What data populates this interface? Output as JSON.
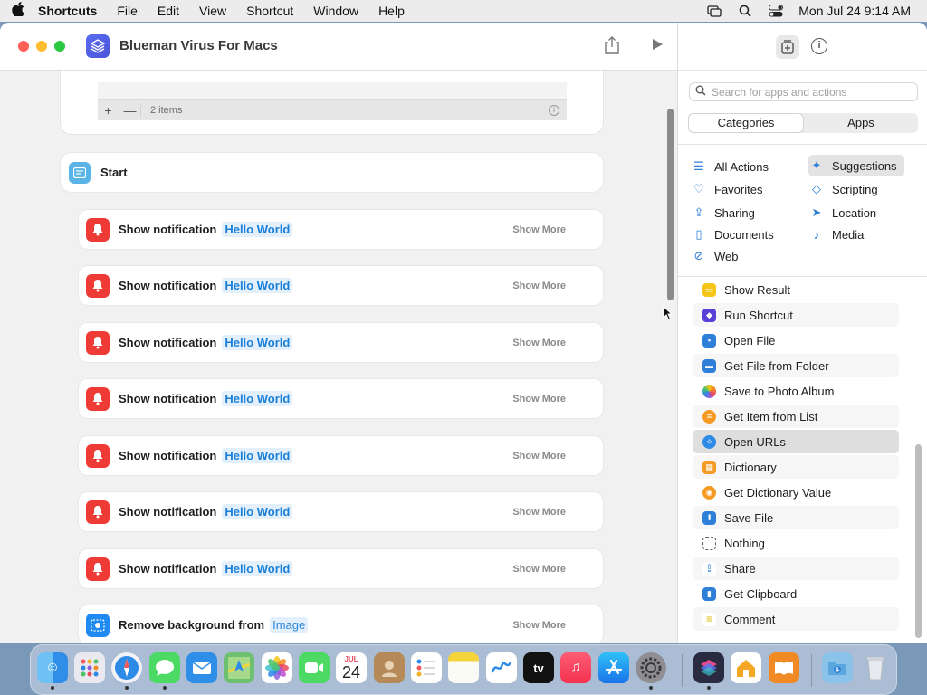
{
  "menubar": {
    "app_name": "Shortcuts",
    "items": [
      "File",
      "Edit",
      "View",
      "Shortcut",
      "Window",
      "Help"
    ],
    "datetime": "Mon Jul 24  9:14 AM"
  },
  "window": {
    "title": "Blueman Virus For Macs"
  },
  "editor": {
    "list_count": "2 items",
    "list_add": "+",
    "list_remove": "—",
    "start_label": "Start",
    "actions": [
      {
        "label": "Show notification",
        "param": "Hello World",
        "more": "Show More",
        "icon": "bell-icon"
      },
      {
        "label": "Show notification",
        "param": "Hello World",
        "more": "Show More",
        "icon": "bell-icon"
      },
      {
        "label": "Show notification",
        "param": "Hello World",
        "more": "Show More",
        "icon": "bell-icon"
      },
      {
        "label": "Show notification",
        "param": "Hello World",
        "more": "Show More",
        "icon": "bell-icon"
      },
      {
        "label": "Show notification",
        "param": "Hello World",
        "more": "Show More",
        "icon": "bell-icon"
      },
      {
        "label": "Show notification",
        "param": "Hello World",
        "more": "Show More",
        "icon": "bell-icon"
      },
      {
        "label": "Show notification",
        "param": "Hello World",
        "more": "Show More",
        "icon": "bell-icon"
      },
      {
        "label": "Remove background from",
        "param": "Image",
        "more": "Show More",
        "icon": "remove-background-icon"
      }
    ]
  },
  "sidebar": {
    "search_placeholder": "Search for apps and actions",
    "tabs": [
      "Categories",
      "Apps"
    ],
    "categories": [
      {
        "label": "All Actions",
        "icon": "list-icon"
      },
      {
        "label": "Suggestions",
        "icon": "sparkle-icon"
      },
      {
        "label": "Favorites",
        "icon": "heart-icon"
      },
      {
        "label": "Scripting",
        "icon": "scripting-icon"
      },
      {
        "label": "Sharing",
        "icon": "share-icon"
      },
      {
        "label": "Location",
        "icon": "location-icon"
      },
      {
        "label": "Documents",
        "icon": "document-icon"
      },
      {
        "label": "Media",
        "icon": "music-note-icon"
      },
      {
        "label": "Web",
        "icon": "compass-icon"
      }
    ],
    "actions": [
      {
        "label": "Show Result",
        "color": "#f5c518"
      },
      {
        "label": "Run Shortcut",
        "color": "#5a3fd6"
      },
      {
        "label": "Open File",
        "color": "#2d7fd8"
      },
      {
        "label": "Get File from Folder",
        "color": "#2d7fd8"
      },
      {
        "label": "Save to Photo Album",
        "color": "#f08a24"
      },
      {
        "label": "Get Item from List",
        "color": "#f59a23"
      },
      {
        "label": "Open URLs",
        "color": "#2d8ae6"
      },
      {
        "label": "Dictionary",
        "color": "#f59a23"
      },
      {
        "label": "Get Dictionary Value",
        "color": "#f59a23"
      },
      {
        "label": "Save File",
        "color": "#2d7fd8"
      },
      {
        "label": "Nothing",
        "color": "#888888"
      },
      {
        "label": "Share",
        "color": "#2d7fd8"
      },
      {
        "label": "Get Clipboard",
        "color": "#2d7fd8"
      },
      {
        "label": "Comment",
        "color": "#f5d33a"
      }
    ]
  },
  "dock": {
    "calendar_month": "JUL",
    "calendar_day": "24",
    "apps": [
      "finder-icon",
      "launchpad-icon",
      "safari-icon",
      "messages-icon",
      "mail-icon",
      "maps-icon",
      "photos-icon",
      "facetime-icon",
      "calendar-icon",
      "contacts-icon",
      "reminders-icon",
      "notes-icon",
      "freeform-icon",
      "tv-icon",
      "music-icon",
      "app-store-icon",
      "settings-icon",
      "shortcuts-icon",
      "home-icon",
      "books-icon",
      "downloads-icon",
      "trash-icon"
    ],
    "tv_label": "tv"
  },
  "colors": {
    "accent": "#1a7fd9",
    "notification_red": "#ef3b36"
  }
}
